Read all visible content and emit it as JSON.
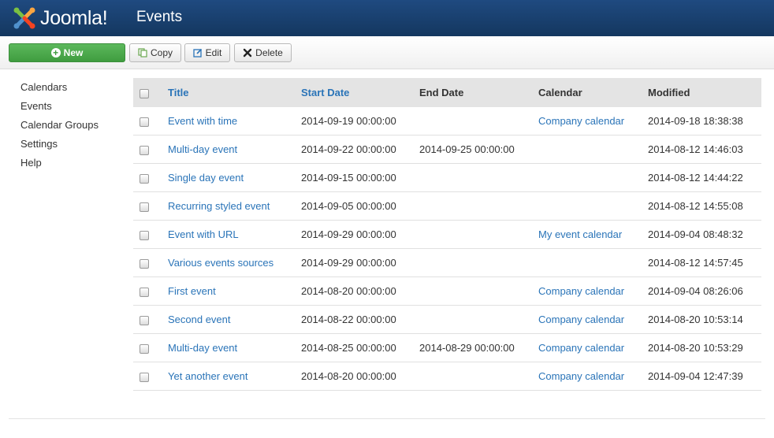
{
  "header": {
    "logo_text": "Joomla!",
    "page_title": "Events"
  },
  "toolbar": {
    "new_label": "New",
    "copy_label": "Copy",
    "edit_label": "Edit",
    "delete_label": "Delete"
  },
  "sidebar": {
    "items": [
      {
        "label": "Calendars"
      },
      {
        "label": "Events"
      },
      {
        "label": "Calendar Groups"
      },
      {
        "label": "Settings"
      },
      {
        "label": "Help"
      }
    ]
  },
  "table": {
    "headers": {
      "title": "Title",
      "start_date": "Start Date",
      "end_date": "End Date",
      "calendar": "Calendar",
      "modified": "Modified"
    },
    "rows": [
      {
        "title": "Event with time",
        "start": "2014-09-19 00:00:00",
        "end": "",
        "calendar": "Company calendar",
        "modified": "2014-09-18 18:38:38"
      },
      {
        "title": "Multi-day event",
        "start": "2014-09-22 00:00:00",
        "end": "2014-09-25 00:00:00",
        "calendar": "",
        "modified": "2014-08-12 14:46:03"
      },
      {
        "title": "Single day event",
        "start": "2014-09-15 00:00:00",
        "end": "",
        "calendar": "",
        "modified": "2014-08-12 14:44:22"
      },
      {
        "title": "Recurring styled event",
        "start": "2014-09-05 00:00:00",
        "end": "",
        "calendar": "",
        "modified": "2014-08-12 14:55:08"
      },
      {
        "title": "Event with URL",
        "start": "2014-09-29 00:00:00",
        "end": "",
        "calendar": "My event calendar",
        "modified": "2014-09-04 08:48:32"
      },
      {
        "title": "Various events sources",
        "start": "2014-09-29 00:00:00",
        "end": "",
        "calendar": "",
        "modified": "2014-08-12 14:57:45"
      },
      {
        "title": "First event",
        "start": "2014-08-20 00:00:00",
        "end": "",
        "calendar": "Company calendar",
        "modified": "2014-09-04 08:26:06"
      },
      {
        "title": "Second event",
        "start": "2014-08-22 00:00:00",
        "end": "",
        "calendar": "Company calendar",
        "modified": "2014-08-20 10:53:14"
      },
      {
        "title": "Multi-day event",
        "start": "2014-08-25 00:00:00",
        "end": "2014-08-29 00:00:00",
        "calendar": "Company calendar",
        "modified": "2014-08-20 10:53:29"
      },
      {
        "title": "Yet another event",
        "start": "2014-08-20 00:00:00",
        "end": "",
        "calendar": "Company calendar",
        "modified": "2014-09-04 12:47:39"
      }
    ]
  },
  "colors": {
    "header_bg": "#1a4070",
    "link": "#2a74b8",
    "new_button": "#4cae4c"
  }
}
